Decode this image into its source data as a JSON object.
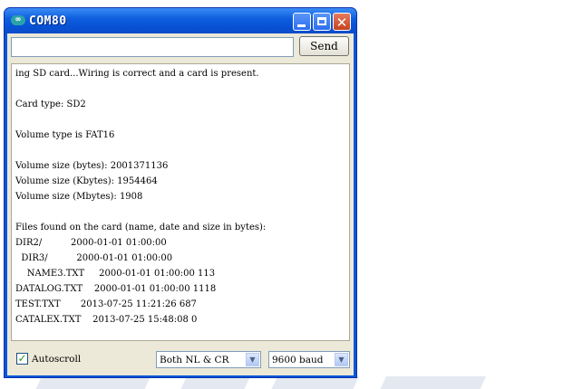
{
  "window": {
    "title": "COM80",
    "app_icon": "∞",
    "controls": {
      "minimize": "minimize-icon",
      "maximize": "maximize-icon",
      "close": "✕"
    }
  },
  "send_bar": {
    "input_value": "",
    "send_label": "Send"
  },
  "output_lines": [
    "ing SD card...Wiring is correct and a card is present.",
    "",
    "Card type: SD2",
    "",
    "Volume type is FAT16",
    "",
    "Volume size (bytes): 2001371136",
    "Volume size (Kbytes): 1954464",
    "Volume size (Mbytes): 1908",
    "",
    "Files found on the card (name, date and size in bytes):",
    "DIR2/          2000-01-01 01:00:00",
    "  DIR3/          2000-01-01 01:00:00",
    "    NAME3.TXT     2000-01-01 01:00:00 113",
    "DATALOG.TXT    2000-01-01 01:00:00 1118",
    "TEST.TXT       2013-07-25 11:21:26 687",
    "CATALEX.TXT    2013-07-25 15:48:08 0"
  ],
  "footer": {
    "autoscroll_label": "Autoscroll",
    "autoscroll_checked": true,
    "line_ending": "Both NL & CR",
    "baud": "9600 baud"
  }
}
